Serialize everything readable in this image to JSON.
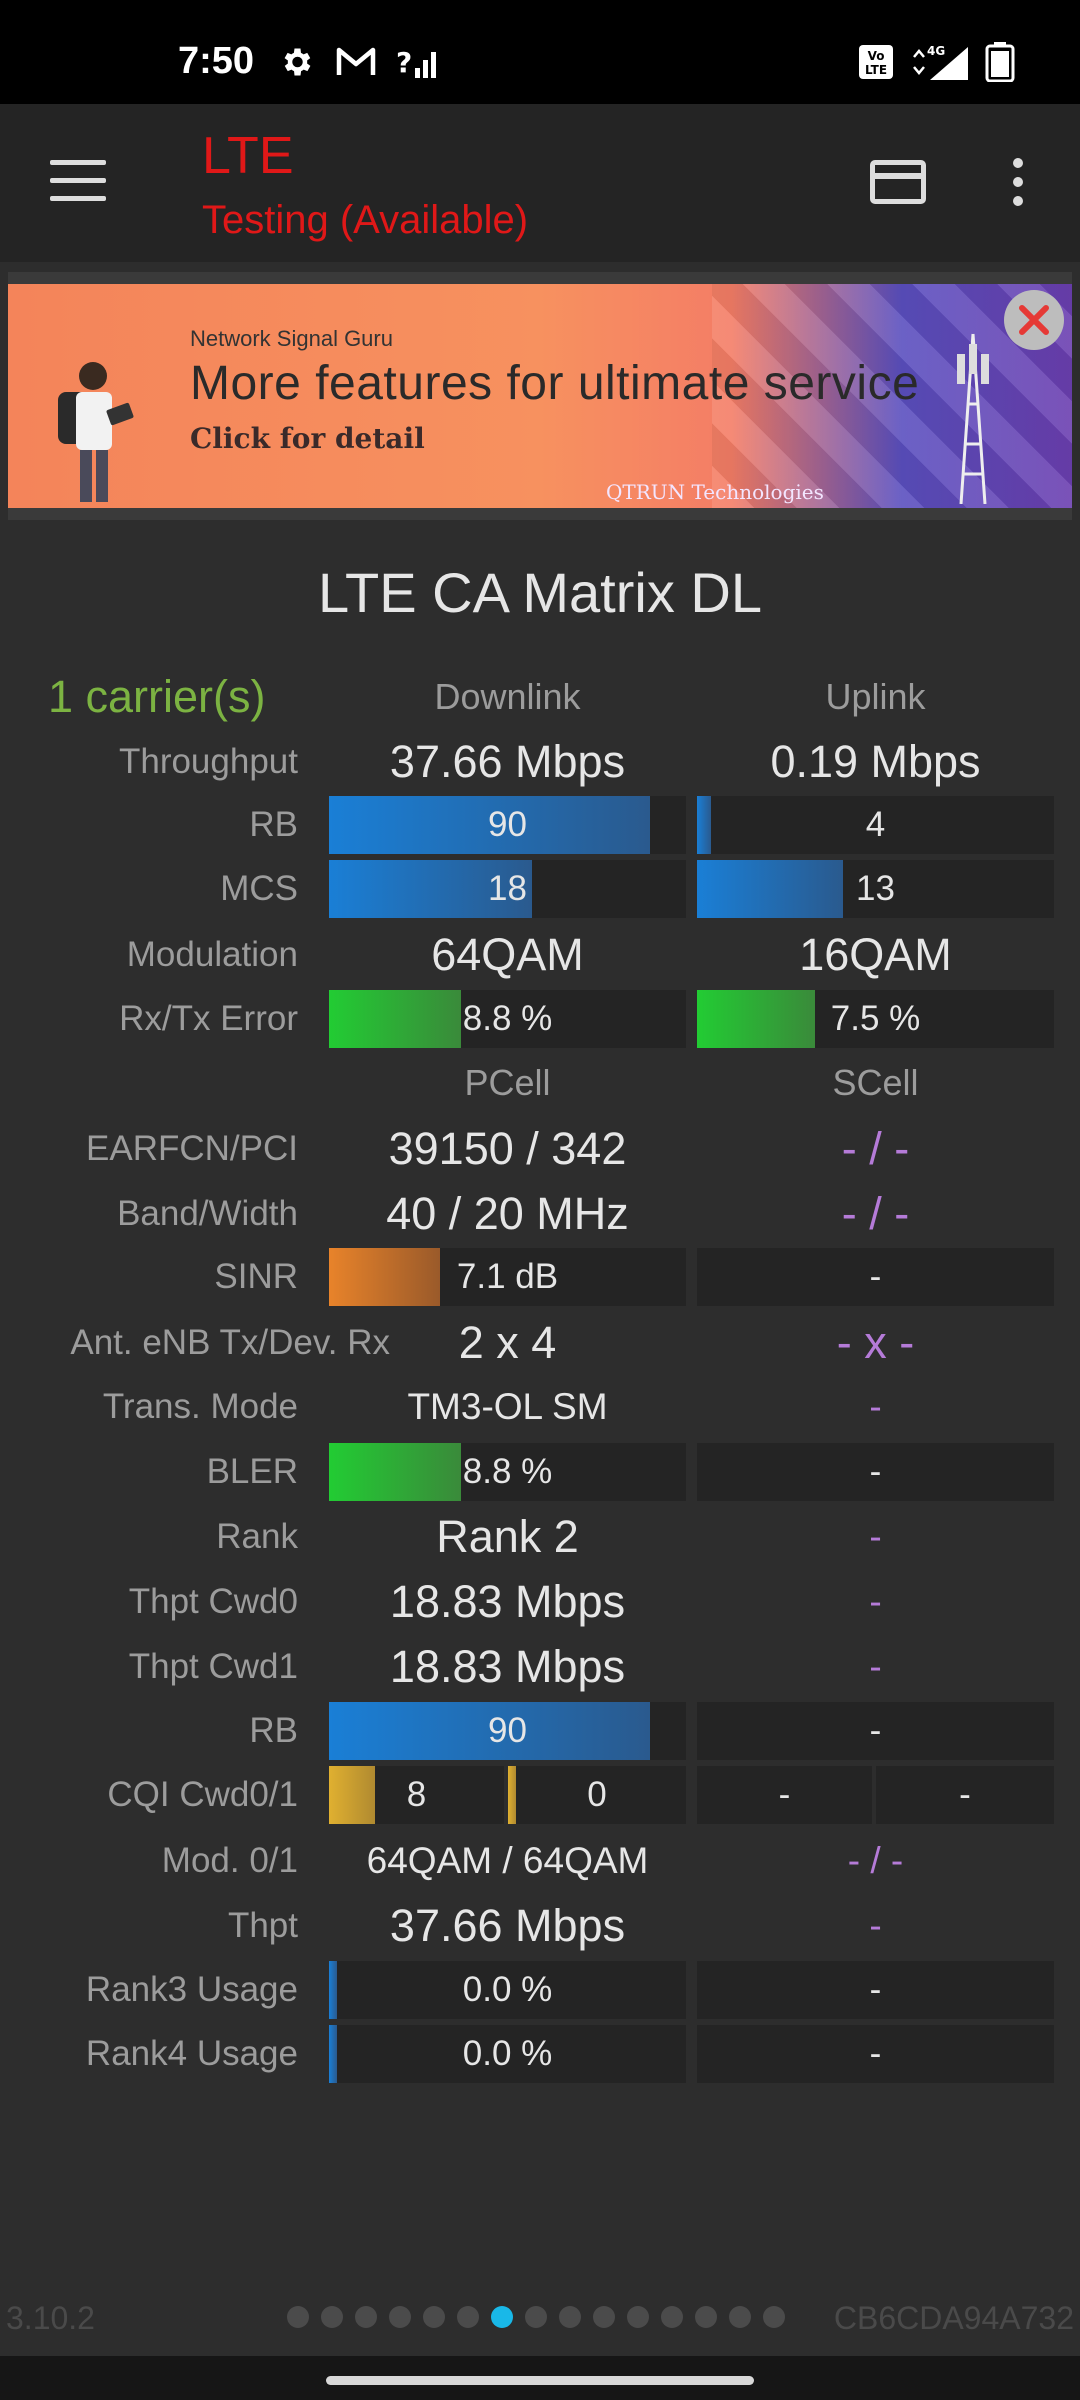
{
  "status_bar": {
    "time": "7:50",
    "volte": "Vo LTE",
    "network": "4G"
  },
  "app_bar": {
    "title": "LTE",
    "subtitle": "Testing (Available)"
  },
  "ad": {
    "brand": "Network Signal Guru",
    "headline": "More features for ultimate service",
    "cta": "Click for detail",
    "company": "QTRUN Technologies"
  },
  "section_title": "LTE CA Matrix DL",
  "carriers": "1 carrier(s)",
  "headers": {
    "downlink": "Downlink",
    "uplink": "Uplink",
    "pcell": "PCell",
    "scell": "SCell"
  },
  "labels": {
    "throughput": "Throughput",
    "rb": "RB",
    "mcs": "MCS",
    "modulation": "Modulation",
    "rxtx_error": "Rx/Tx Error",
    "earfcn_pci": "EARFCN/PCI",
    "band_width": "Band/Width",
    "sinr": "SINR",
    "ant": "Ant. eNB Tx/Dev. Rx",
    "trans_mode": "Trans. Mode",
    "bler": "BLER",
    "rank": "Rank",
    "thpt_cwd0": "Thpt Cwd0",
    "thpt_cwd1": "Thpt Cwd1",
    "rb2": "RB",
    "cqi": "CQI Cwd0/1",
    "mod01": "Mod. 0/1",
    "thpt": "Thpt",
    "rank3_usage": "Rank3 Usage",
    "rank4_usage": "Rank4 Usage"
  },
  "downlink": {
    "throughput": "37.66 Mbps",
    "rb": "90",
    "rb_level": 0.9,
    "mcs": "18",
    "mcs_level": 0.57,
    "modulation": "64QAM",
    "error": "8.8 %",
    "error_level": 0.37
  },
  "uplink": {
    "throughput": "0.19 Mbps",
    "rb": "4",
    "rb_level": 0.04,
    "mcs": "13",
    "mcs_level": 0.41,
    "modulation": "16QAM",
    "error": "7.5 %",
    "error_level": 0.33
  },
  "pcell": {
    "earfcn_pci": "39150 / 342",
    "band_width": "40 / 20 MHz",
    "sinr": "7.1 dB",
    "sinr_level": 0.31,
    "ant": "2 x 4",
    "trans_mode": "TM3-OL SM",
    "bler": "8.8 %",
    "bler_level": 0.37,
    "rank": "Rank 2",
    "thpt_cwd0": "18.83 Mbps",
    "thpt_cwd1": "18.83 Mbps",
    "rb": "90",
    "rb_level": 0.9,
    "cqi0": "8",
    "cqi0_level": 0.26,
    "cqi1": "0",
    "cqi1_level": 0.04,
    "mod01": "64QAM / 64QAM",
    "thpt": "37.66 Mbps",
    "rank3_usage": "0.0 %",
    "rank3_level": 0.02,
    "rank4_usage": "0.0 %",
    "rank4_level": 0.02
  },
  "scell": {
    "earfcn_pci": "- / -",
    "band_width": "- / -",
    "sinr": "-",
    "ant": "- x -",
    "trans_mode": "-",
    "bler": "-",
    "rank": "-",
    "thpt_cwd0": "-",
    "thpt_cwd1": "-",
    "rb": "-",
    "cqi0": "-",
    "cqi1": "-",
    "mod01": "- / -",
    "thpt": "-",
    "rank3_usage": "-",
    "rank4_usage": "-"
  },
  "footer": {
    "version": "3.10.2",
    "device_id": "CB6CDA94A732",
    "page_count": 15,
    "active_page": 7
  },
  "colors": {
    "accent_red": "#e01818",
    "carrier_green": "#7cb342",
    "scell_purple": "#b57bd8",
    "page_dot_active": "#19b8e8"
  }
}
